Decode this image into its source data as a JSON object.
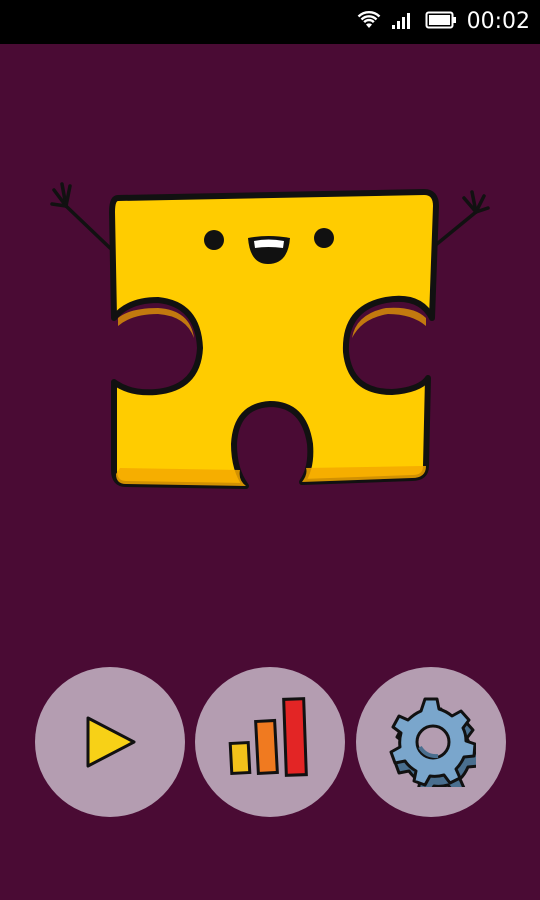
{
  "status_bar": {
    "time": "00:02",
    "icons": [
      "wifi-icon",
      "signal-icon",
      "battery-icon"
    ]
  },
  "mascot": {
    "name": "puzzle-piece-mascot",
    "color": "#ffcc00",
    "shadow_color": "#f5a800"
  },
  "menu": {
    "buttons": [
      {
        "name": "play-button",
        "icon": "play-icon"
      },
      {
        "name": "stats-button",
        "icon": "bar-chart-icon"
      },
      {
        "name": "settings-button",
        "icon": "gear-icon"
      }
    ],
    "button_color": "#b49db1"
  },
  "colors": {
    "background": "#4a0b34",
    "status_bar": "#000000",
    "play_yellow": "#f7d117",
    "bar_yellow": "#f2c21a",
    "bar_orange": "#f07a20",
    "bar_red": "#e32525",
    "gear_blue": "#7aa6cc"
  }
}
